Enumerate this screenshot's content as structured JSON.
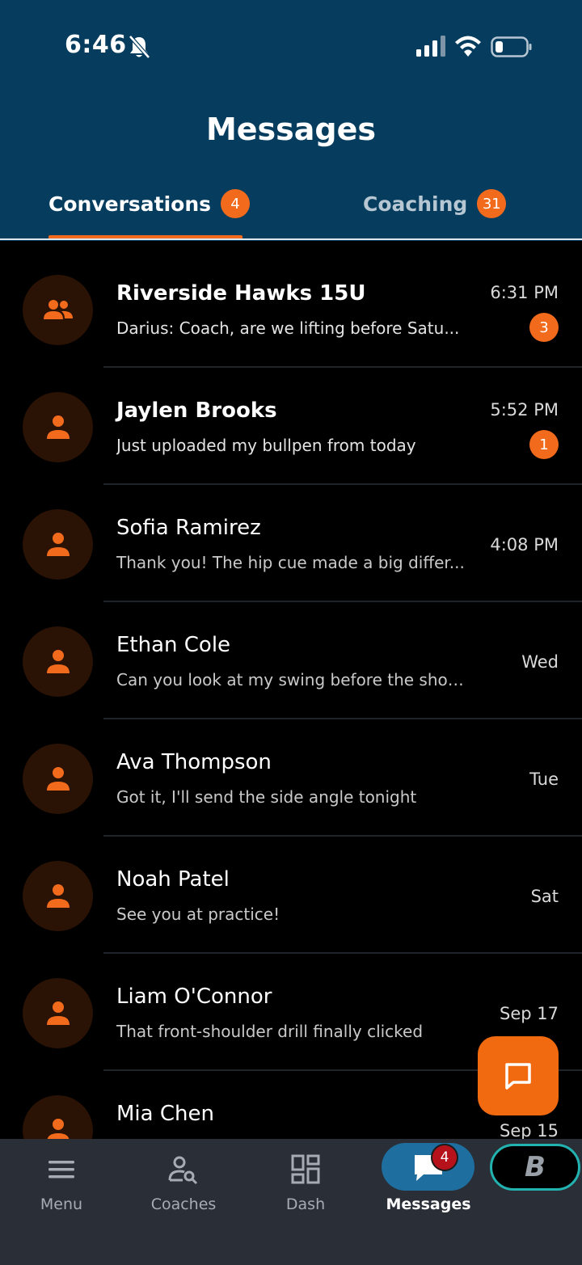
{
  "status_bar": {
    "time": "6:46"
  },
  "header": {
    "title": "Messages"
  },
  "tabs": [
    {
      "label": "Conversations",
      "badge": "4",
      "active": true
    },
    {
      "label": "Coaching",
      "badge": "31",
      "active": false
    }
  ],
  "conversations": [
    {
      "name": "Riverside Hawks 15U",
      "preview": "Darius: Coach, are we lifting before Satu...",
      "time": "6:31 PM",
      "unread": "3",
      "type": "group",
      "bold": true
    },
    {
      "name": "Jaylen Brooks",
      "preview": "Just uploaded my bullpen from today",
      "time": "5:52 PM",
      "unread": "1",
      "type": "person",
      "bold": true
    },
    {
      "name": "Sofia Ramirez",
      "preview": "Thank you! The hip cue made a big differ...",
      "time": "4:08 PM",
      "unread": "",
      "type": "person",
      "bold": false
    },
    {
      "name": "Ethan Cole",
      "preview": "Can you look at my swing before the showca...",
      "time": "Wed",
      "unread": "",
      "type": "person",
      "bold": false
    },
    {
      "name": "Ava Thompson",
      "preview": "Got it, I'll send the side angle tonight",
      "time": "Tue",
      "unread": "",
      "type": "person",
      "bold": false
    },
    {
      "name": "Noah Patel",
      "preview": "See you at practice!",
      "time": "Sat",
      "unread": "",
      "type": "person",
      "bold": false
    },
    {
      "name": "Liam O'Connor",
      "preview": "That front-shoulder drill finally clicked",
      "time": "Sep 17",
      "unread": "",
      "type": "person",
      "bold": false
    },
    {
      "name": "Mia Chen",
      "preview": "",
      "time": "Sep 15",
      "unread": "",
      "type": "person",
      "bold": false
    }
  ],
  "bottom_nav": {
    "menu": "Menu",
    "coaches": "Coaches",
    "dash": "Dash",
    "messages": "Messages",
    "messages_badge": "4",
    "brand_letter": "B"
  },
  "colors": {
    "header_bg": "#063d5e",
    "accent": "#f26a1b",
    "nav_bg": "#2a2e36",
    "active_pill": "#1e6e9f",
    "brand_ring": "#22b3b0"
  },
  "icons": {
    "fab": "new-message-icon",
    "group": "group-icon",
    "person": "person-icon"
  }
}
